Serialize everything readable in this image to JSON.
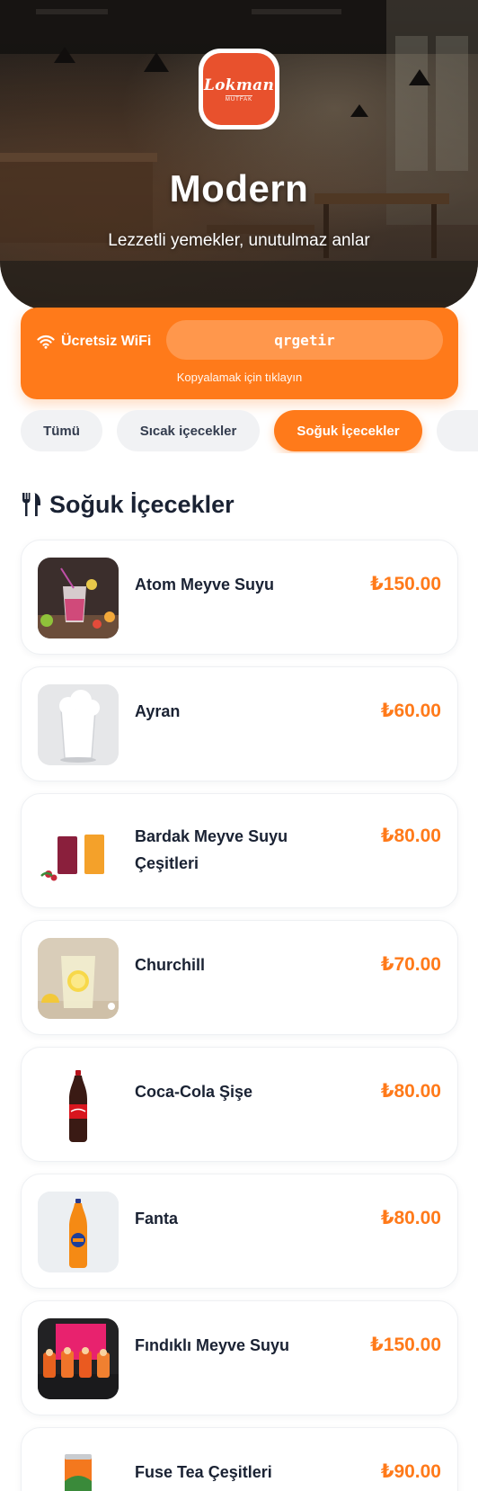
{
  "hero": {
    "title": "Modern",
    "subtitle": "Lezzetli yemekler, unutulmaz anlar",
    "logo": {
      "word": "Lokman",
      "sub": "MUTFAK",
      "color": "#e8512d"
    }
  },
  "wifi": {
    "label": "Ücretsiz WiFi",
    "password": "qrgetir",
    "hint": "Kopyalamak için tıklayın",
    "icon": "wifi-icon"
  },
  "tabs": [
    {
      "label": "Tümü",
      "active": false
    },
    {
      "label": "Sıcak içecekler",
      "active": false
    },
    {
      "label": "Soğuk İçecekler",
      "active": true
    },
    {
      "label": "",
      "active": false
    }
  ],
  "section": {
    "title": "Soğuk İçecekler",
    "icon": "fork-knife-icon"
  },
  "items": [
    {
      "name": "Atom Meyve Suyu",
      "price": "₺150.00"
    },
    {
      "name": "Ayran",
      "price": "₺60.00"
    },
    {
      "name": "Bardak Meyve Suyu Çeşitleri",
      "price": "₺80.00"
    },
    {
      "name": "Churchill",
      "price": "₺70.00"
    },
    {
      "name": "Coca-Cola Şişe",
      "price": "₺80.00"
    },
    {
      "name": "Fanta",
      "price": "₺80.00"
    },
    {
      "name": "Fındıklı Meyve Suyu",
      "price": "₺150.00"
    },
    {
      "name": "Fuse Tea Çeşitleri",
      "price": "₺90.00"
    }
  ],
  "colors": {
    "accent": "#ff7a1a",
    "text": "#1a2233"
  }
}
